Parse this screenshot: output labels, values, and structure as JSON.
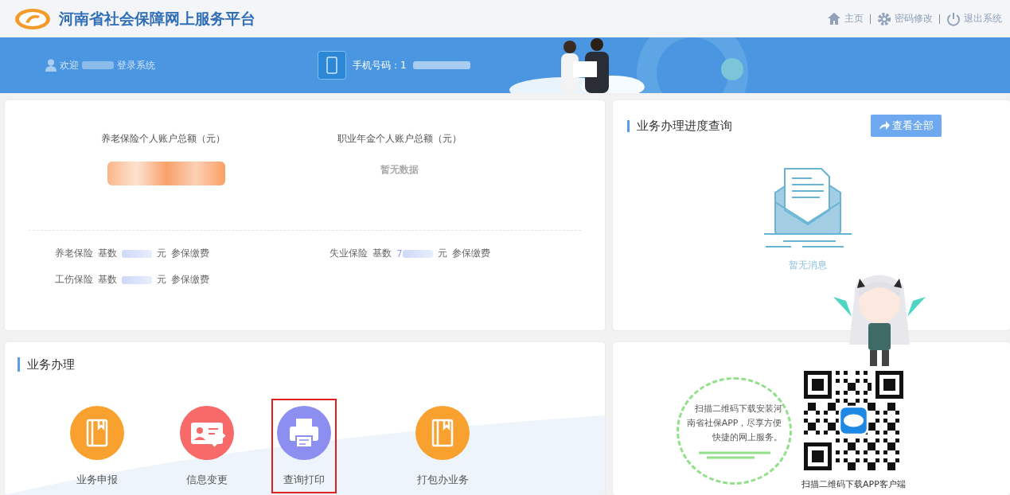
{
  "header": {
    "title": "河南省社会保障网上服务平台",
    "nav": [
      {
        "kind": "home",
        "label": "主页"
      },
      {
        "kind": "gear",
        "label": "密码修改"
      },
      {
        "kind": "power",
        "label": "退出系统"
      }
    ]
  },
  "banner": {
    "welcome_prefix": "欢迎",
    "welcome_suffix": "登录系统",
    "phone_label": "手机号码：",
    "phone_visible": "1"
  },
  "accounts": [
    {
      "kind": "redacted",
      "label": "养老保险个人账户总额（元）"
    },
    {
      "kind": "empty",
      "label": "职业年金个人账户总额（元）",
      "empty_text": "暂无数据"
    }
  ],
  "insurance": [
    {
      "name": "养老保险",
      "base_label": "基数",
      "unit": "元",
      "status": "参保缴费"
    },
    {
      "name": "失业保险",
      "base_label": "基数",
      "base_visible": "7",
      "unit": "元",
      "status": "参保缴费"
    },
    {
      "name": "工伤保险",
      "base_label": "基数",
      "unit": "元",
      "status": "参保缴费"
    }
  ],
  "progress": {
    "title": "业务办理进度查询",
    "button": "查看全部",
    "empty_text": "暂无消息"
  },
  "services": {
    "title": "业务办理",
    "items": [
      {
        "kind": "book",
        "label": "业务申报",
        "color": "#f9a12f",
        "selected": false
      },
      {
        "kind": "card",
        "label": "信息变更",
        "color": "#f86a6a",
        "selected": false
      },
      {
        "kind": "printer",
        "label": "查询打印",
        "color": "#8c8ff0",
        "selected": true
      },
      {
        "kind": "book",
        "label": "打包办业务",
        "color": "#f9a12f",
        "selected": false
      }
    ]
  },
  "app": {
    "bubble_text": "扫描二维码下载安装河南省社保APP，尽享方便快捷的网上服务。",
    "caption": "扫描二维码下载APP客户端"
  }
}
